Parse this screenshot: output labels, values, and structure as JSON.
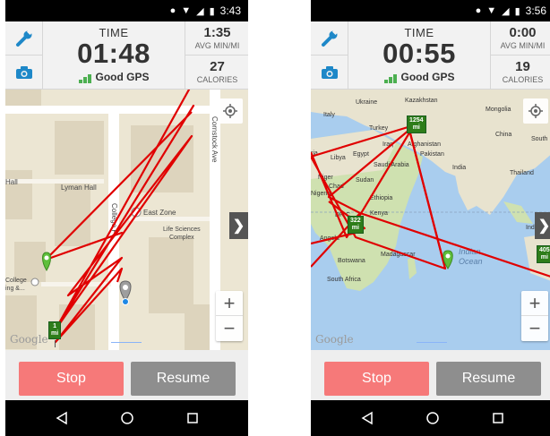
{
  "colors": {
    "accent_stop": "#f67979",
    "resume": "#8e8e8e",
    "route": "#e00000",
    "gps_good": "#4caf50",
    "mile_marker": "#2e7d1a"
  },
  "screens": [
    {
      "status": {
        "clock": "3:43"
      },
      "time": {
        "label": "TIME",
        "value": "01:48"
      },
      "gps": {
        "label": "Good GPS"
      },
      "pace": {
        "value": "1:35",
        "label": "AVG MIN/MI"
      },
      "calories": {
        "value": "27",
        "label": "CALORIES"
      },
      "map": {
        "labels": {
          "cornstock": "Cornstock Ave",
          "hall": "Hall",
          "lyman": "Lyman Hall",
          "college_pl": "College Pl",
          "east_zone": "East Zone",
          "life_sciences": "Life Sciences",
          "complex": "Complex",
          "college_left": "College",
          "ing": "ing &..."
        },
        "mile_markers": [
          {
            "top": "1",
            "bottom": "mi"
          }
        ]
      },
      "google": "Google",
      "buttons": {
        "stop": "Stop",
        "resume": "Resume"
      }
    },
    {
      "status": {
        "clock": "3:56"
      },
      "time": {
        "label": "TIME",
        "value": "00:55"
      },
      "gps": {
        "label": "Good GPS"
      },
      "pace": {
        "value": "0:00",
        "label": "AVG MIN/MI"
      },
      "calories": {
        "value": "19",
        "label": "CALORIES"
      },
      "map": {
        "labels": {
          "ukraine": "Ukraine",
          "kazakhstan": "Kazakhstan",
          "mongolia": "Mongolia",
          "italy": "Italy",
          "turkey": "Turkey",
          "iraq": "Iraq",
          "afghanistan": "Afghanistan",
          "pakistan": "Pakistan",
          "china": "China",
          "south": "South",
          "libya": "Libya",
          "egypt": "Egypt",
          "saudi": "Saudi Arabia",
          "india": "India",
          "thailand": "Thailand",
          "niger": "Niger",
          "chad": "Chad",
          "sudan": "Sudan",
          "ethiopia": "Ethiopia",
          "nigeria": "Nigeria",
          "drc": "DR C",
          "kenya": "Kenya",
          "indo": "Indo",
          "angola": "Angola",
          "indian": "Indian",
          "ocean": "Ocean",
          "botswana": "Botswana",
          "madagascar": "Madagascar",
          "south_africa": "South Africa",
          "ria": "ria"
        },
        "mile_markers": [
          {
            "top": "1254",
            "bottom": "mi"
          },
          {
            "top": "322",
            "bottom": "mi"
          },
          {
            "top": "405",
            "bottom": "mi"
          }
        ]
      },
      "google": "Google",
      "buttons": {
        "stop": "Stop",
        "resume": "Resume"
      }
    }
  ]
}
